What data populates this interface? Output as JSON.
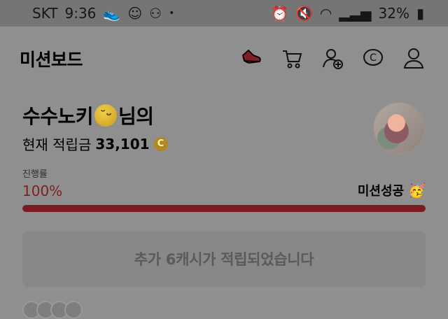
{
  "status_bar": {
    "carrier": "SKT",
    "time": "9:36",
    "dot": "•",
    "battery": "32%",
    "icons": [
      "shoe-status-icon",
      "face-status-icon",
      "link-status-icon",
      "alarm-icon",
      "mute-icon",
      "wifi-icon",
      "signal-icon"
    ]
  },
  "header": {
    "title": "미션보드",
    "icons": [
      "shoe-icon",
      "cart-icon",
      "add-user-icon",
      "coin-icon",
      "user-icon"
    ]
  },
  "profile": {
    "name": "수수노키",
    "suffix": "님의",
    "points_label": "현재 적립금",
    "points_value": "33,101",
    "coin_symbol": "C"
  },
  "mission": {
    "progress_label": "진행률",
    "progress_text": "100%",
    "progress_fraction": 1.0,
    "success_text": "미션성공",
    "party_icon": "🥳"
  },
  "notice": {
    "message": "추가 6캐시가 적립되었습니다"
  },
  "colors": {
    "overlay_gray": "#8f8f8f",
    "status_gray": "#757575",
    "accent_red": "#7b1b22",
    "coin_gold": "#b1891e"
  }
}
